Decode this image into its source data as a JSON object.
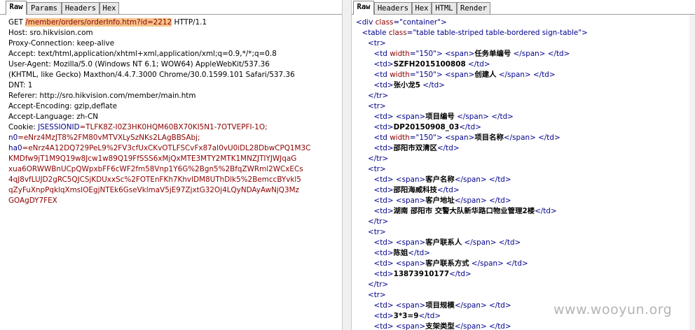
{
  "left_panel": {
    "tabs": [
      "Raw",
      "Params",
      "Headers",
      "Hex"
    ],
    "request": {
      "method": "GET",
      "path_prefix": " ",
      "url": "/member/orders/orderInfo.htm?id=2212",
      "protocol": " HTTP/1.1",
      "headers": [
        "Host: sro.hikvision.com",
        "Proxy-Connection: keep-alive",
        "Accept: text/html,application/xhtml+xml,application/xml;q=0.9,*/*;q=0.8",
        "User-Agent: Mozilla/5.0 (Windows NT 6.1; WOW64) AppleWebKit/537.36",
        "(KHTML, like Gecko) Maxthon/4.4.7.3000 Chrome/30.0.1599.101 Safari/537.36",
        "DNT: 1",
        "Referer: http://sro.hikvision.com/member/main.htm",
        "Accept-Encoding: gzip,deflate",
        "Accept-Language: zh-CN"
      ],
      "cookie_label": "Cookie: ",
      "cookie_name_1": "JSESSIONID",
      "cookie_val_1": "=TLFK8Z-I0Z3HK0HQM60BX70KI5N1-7OTVEPFI-1O;",
      "cookie_name_2": "n0",
      "cookie_val_2": "=eNrz4MzJT8%2FM80vMTVXLySzNKs2LAgBBSAbj;",
      "cookie_name_3": "ha0",
      "cookie_val_3": "=eNrz4A12DQ729PeL9%2FV3cfUxCKvOTLFSCvFx87aI0vU0iDL28DbwCPQ1M3C",
      "cookie_cont": [
        "KMDfw9jT1M9Q19w8Jcw1w89Q19FfSSS6xMjQxMTE3MTY2MTK1MNZJTIYJWJqaG",
        "xua6ORWWBnUCpQWpxbFF6cWF2fm58Vnp1Y6G%2Bgn5%2BfqZWRml2WCxECs",
        "4qJ8vfLUJD2gRC5QJCSjKDUxxSc%2FOTEnFKh7KhvIDM8UThDlk5%2BemccBYvkl5",
        "qZyFuXnpPqklqXmsIOEgjNTEk6GseVklmaV5jE97ZjxtG32Oj4LQyNDAyAwNjQ3Mz",
        "GOAgDY7FEX"
      ]
    }
  },
  "right_panel": {
    "tabs": [
      "Raw",
      "Headers",
      "Hex",
      "HTML",
      "Render"
    ],
    "html_lines": [
      {
        "indent": 0,
        "parts": [
          [
            "tg",
            "<div "
          ],
          [
            "at",
            "class"
          ],
          [
            "tg",
            "=\""
          ],
          [
            "av",
            "container"
          ],
          [
            "tg",
            "\">"
          ]
        ]
      },
      {
        "indent": 1,
        "parts": [
          [
            "tg",
            "<table "
          ],
          [
            "at",
            "class"
          ],
          [
            "tg",
            "=\""
          ],
          [
            "av",
            "table table-striped table-bordered sign-table"
          ],
          [
            "tg",
            "\">"
          ]
        ]
      },
      {
        "indent": 2,
        "parts": [
          [
            "tg",
            "<tr>"
          ]
        ]
      },
      {
        "indent": 3,
        "parts": [
          [
            "tg",
            "<td "
          ],
          [
            "at",
            "width"
          ],
          [
            "tg",
            "=\""
          ],
          [
            "av",
            "150"
          ],
          [
            "tg",
            "\"> <span>"
          ],
          [
            "t",
            "任务单编号"
          ],
          [
            "tg",
            " </span> </td>"
          ]
        ]
      },
      {
        "indent": 3,
        "parts": [
          [
            "tg",
            "<td>"
          ],
          [
            "t",
            "SZFH2015100808"
          ],
          [
            "tg",
            " </td>"
          ]
        ]
      },
      {
        "indent": 3,
        "parts": [
          [
            "tg",
            "<td "
          ],
          [
            "at",
            "width"
          ],
          [
            "tg",
            "=\""
          ],
          [
            "av",
            "150"
          ],
          [
            "tg",
            "\"> <span>"
          ],
          [
            "t",
            "创建人"
          ],
          [
            "tg",
            " </span> </td>"
          ]
        ]
      },
      {
        "indent": 3,
        "parts": [
          [
            "tg",
            "<td>"
          ],
          [
            "t",
            "张小龙5"
          ],
          [
            "tg",
            " </td>"
          ]
        ]
      },
      {
        "indent": 2,
        "parts": [
          [
            "tg",
            "</tr>"
          ]
        ]
      },
      {
        "indent": 2,
        "parts": [
          [
            "tg",
            "<tr>"
          ]
        ]
      },
      {
        "indent": 3,
        "parts": [
          [
            "tg",
            "<td> <span>"
          ],
          [
            "t",
            "项目编号"
          ],
          [
            "tg",
            " </span> </td>"
          ]
        ]
      },
      {
        "indent": 3,
        "parts": [
          [
            "tg",
            "<td>"
          ],
          [
            "t",
            "DP20150908_03"
          ],
          [
            "tg",
            "</td>"
          ]
        ]
      },
      {
        "indent": 3,
        "parts": [
          [
            "tg",
            "<td "
          ],
          [
            "at",
            "width"
          ],
          [
            "tg",
            "=\""
          ],
          [
            "av",
            "150"
          ],
          [
            "tg",
            "\"> <span>"
          ],
          [
            "t",
            "项目名称"
          ],
          [
            "tg",
            "</span> </td>"
          ]
        ]
      },
      {
        "indent": 3,
        "parts": [
          [
            "tg",
            "<td>"
          ],
          [
            "t",
            "邵阳市双清区"
          ],
          [
            "tg",
            "</td>"
          ]
        ]
      },
      {
        "indent": 2,
        "parts": [
          [
            "tg",
            "</tr>"
          ]
        ]
      },
      {
        "indent": 2,
        "parts": [
          [
            "tg",
            "<tr>"
          ]
        ]
      },
      {
        "indent": 3,
        "parts": [
          [
            "tg",
            "<td> <span>"
          ],
          [
            "t",
            "客户名称"
          ],
          [
            "tg",
            "</span> </td>"
          ]
        ]
      },
      {
        "indent": 3,
        "parts": [
          [
            "tg",
            "<td>"
          ],
          [
            "t",
            "邵阳海威科技"
          ],
          [
            "tg",
            "</td>"
          ]
        ]
      },
      {
        "indent": 3,
        "parts": [
          [
            "tg",
            "<td> <span>"
          ],
          [
            "t",
            "客户地址"
          ],
          [
            "tg",
            "</span> </td>"
          ]
        ]
      },
      {
        "indent": 3,
        "parts": [
          [
            "tg",
            "<td>"
          ],
          [
            "t",
            "湖南 邵阳市 交警大队新华路口物业管理2楼"
          ],
          [
            "tg",
            "</td>"
          ]
        ]
      },
      {
        "indent": 2,
        "parts": [
          [
            "tg",
            "</tr>"
          ]
        ]
      },
      {
        "indent": 2,
        "parts": [
          [
            "tg",
            "<tr>"
          ]
        ]
      },
      {
        "indent": 3,
        "parts": [
          [
            "tg",
            "<td> <span>"
          ],
          [
            "t",
            "客户联系人"
          ],
          [
            "tg",
            " </span> </td>"
          ]
        ]
      },
      {
        "indent": 3,
        "parts": [
          [
            "tg",
            "<td>"
          ],
          [
            "t",
            "陈姐"
          ],
          [
            "tg",
            "</td>"
          ]
        ]
      },
      {
        "indent": 3,
        "parts": [
          [
            "tg",
            "<td> <span>"
          ],
          [
            "t",
            "客户联系方式"
          ],
          [
            "tg",
            " </span> </td>"
          ]
        ]
      },
      {
        "indent": 3,
        "parts": [
          [
            "tg",
            "<td>"
          ],
          [
            "t",
            "13873910177"
          ],
          [
            "tg",
            "</td>"
          ]
        ]
      },
      {
        "indent": 2,
        "parts": [
          [
            "tg",
            "</tr>"
          ]
        ]
      },
      {
        "indent": 2,
        "parts": [
          [
            "tg",
            "<tr>"
          ]
        ]
      },
      {
        "indent": 3,
        "parts": [
          [
            "tg",
            "<td> <span>"
          ],
          [
            "t",
            "项目规模"
          ],
          [
            "tg",
            "</span> </td>"
          ]
        ]
      },
      {
        "indent": 3,
        "parts": [
          [
            "tg",
            "<td>"
          ],
          [
            "t",
            "3*3=9"
          ],
          [
            "tg",
            "</td>"
          ]
        ]
      },
      {
        "indent": 3,
        "parts": [
          [
            "tg",
            "<td> <span>"
          ],
          [
            "t",
            "支架类型"
          ],
          [
            "tg",
            "</span> </td>"
          ]
        ]
      }
    ]
  },
  "watermark": "www.wooyun.org"
}
